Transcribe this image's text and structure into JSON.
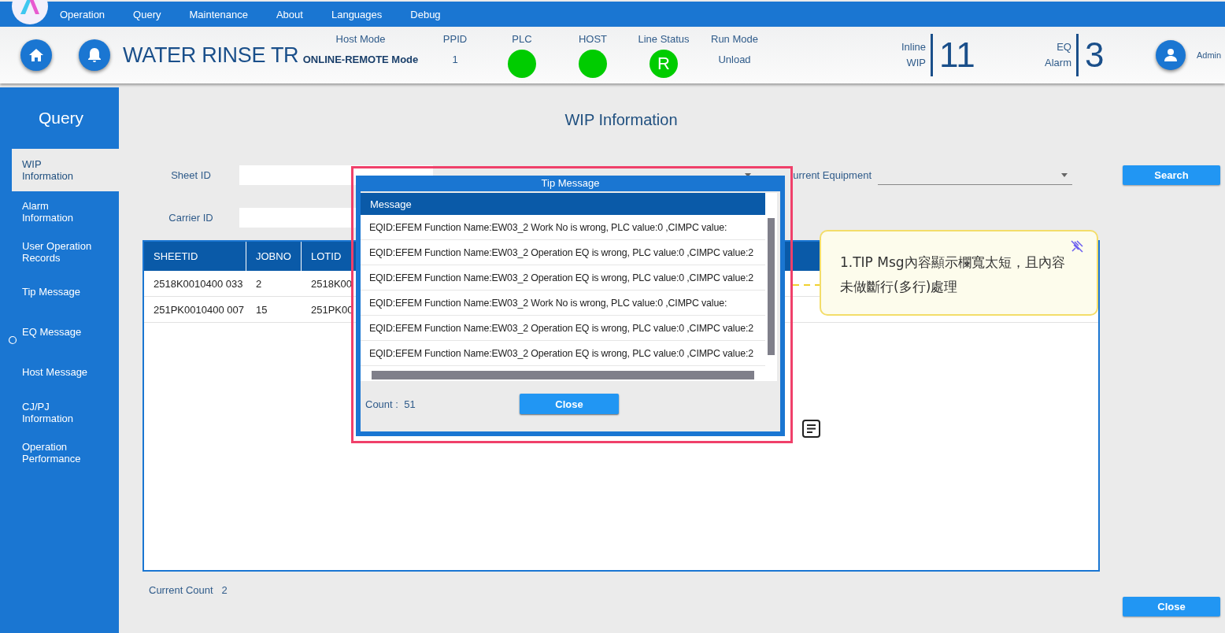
{
  "menu": [
    "Operation",
    "Query",
    "Maintenance",
    "About",
    "Languages",
    "Debug"
  ],
  "header": {
    "title": "WATER RINSE TR",
    "status": [
      {
        "kind": "mode",
        "label": "Host Mode",
        "value": "ONLINE-REMOTE Mode"
      },
      {
        "kind": "text",
        "label": "PPID",
        "value": "1"
      },
      {
        "kind": "dot",
        "label": "PLC",
        "color": "#00cc00"
      },
      {
        "kind": "dot",
        "label": "HOST",
        "color": "#00cc00"
      },
      {
        "kind": "dot",
        "label": "Line Status",
        "color": "#00cc00",
        "value": "R"
      },
      {
        "kind": "text",
        "label": "Run Mode",
        "value": "Unload"
      }
    ],
    "counters": [
      {
        "label": "Inline WIP",
        "value": "11"
      },
      {
        "label": "EQ Alarm",
        "value": "3"
      }
    ],
    "user": "Admin"
  },
  "sidebar": {
    "title": "Query",
    "items": [
      {
        "label": "WIP Information",
        "selected": true
      },
      {
        "label": "Alarm Information",
        "selected": false
      },
      {
        "label": "User Operation Records",
        "selected": false
      },
      {
        "label": "Tip Message",
        "selected": false
      },
      {
        "label": "EQ Message",
        "selected": false
      },
      {
        "label": "Host Message",
        "selected": false
      },
      {
        "label": "CJ/PJ Information",
        "selected": false
      },
      {
        "label": "Operation Performance",
        "selected": false
      }
    ]
  },
  "page": {
    "title": "WIP Information",
    "form": {
      "sheet_id_label": "Sheet ID",
      "equipment_label": "urrent Equipment",
      "search_button": "Search",
      "carrier_id_label": "Carrier ID"
    },
    "table": {
      "columns": [
        "SHEETID",
        "JOBNO",
        "LOTID"
      ],
      "rows": [
        [
          "2518K0010400 033",
          "2",
          "2518K00"
        ],
        [
          "251PK0010400 007",
          "15",
          "251PK00"
        ]
      ]
    },
    "current_count": {
      "label": "Current Count",
      "value": "2"
    },
    "close_button": "Close"
  },
  "dialog": {
    "title": "Tip Message",
    "column": "Message",
    "rows": [
      "EQID:EFEM Function Name:EW03_2 Work No is wrong, PLC value:0 ,CIMPC value:",
      "EQID:EFEM Function Name:EW03_2 Operation EQ is wrong, PLC value:0 ,CIMPC value:2",
      "EQID:EFEM Function Name:EW03_2 Operation EQ is wrong, PLC value:0 ,CIMPC value:2",
      "EQID:EFEM Function Name:EW03_2 Work No is wrong, PLC value:0 ,CIMPC value:",
      "EQID:EFEM Function Name:EW03_2 Operation EQ is wrong, PLC value:0 ,CIMPC value:2",
      "EQID:EFEM Function Name:EW03_2 Operation EQ is wrong, PLC value:0 ,CIMPC value:2"
    ],
    "count_label": "Count :",
    "count": "51",
    "close_button": "Close"
  },
  "annotation": {
    "text": "1.TIP Msg內容顯示欄寬太短，且內容未做斷行(多行)處理"
  }
}
